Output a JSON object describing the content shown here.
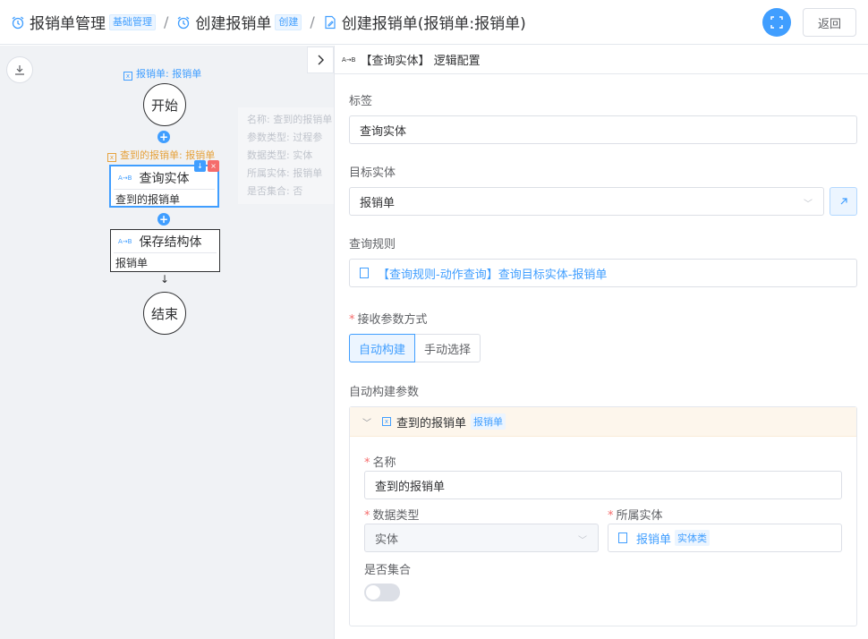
{
  "breadcrumb": [
    {
      "label": "报销单管理",
      "tag": "基础管理"
    },
    {
      "label": "创建报销单",
      "tag": "创建"
    },
    {
      "label": "创建报销单(报销单:报销单)"
    }
  ],
  "separator": "/",
  "back_label": "返回",
  "flow": {
    "root_var": "报销单: 报销单",
    "start_label": "开始",
    "query_var": "查到的报销单: 报销单",
    "query_node": {
      "title": "查询实体",
      "subtitle": "查到的报销单"
    },
    "save_node": {
      "title": "保存结构体",
      "subtitle": "报销单"
    },
    "end_label": "结束",
    "info": [
      "名称: 查到的报销单",
      "参数类型: 过程参",
      "数据类型: 实体",
      "所属实体: 报销单",
      "是否集合: 否"
    ]
  },
  "panel": {
    "title": "【查询实体】 逻辑配置",
    "label_field": {
      "label": "标签",
      "value": "查询实体"
    },
    "target_entity": {
      "label": "目标实体",
      "value": "报销单"
    },
    "query_rule": {
      "label": "查询规则",
      "value": "【查询规则-动作查询】查询目标实体-报销单"
    },
    "receive_mode": {
      "label": "接收参数方式",
      "options": [
        "自动构建",
        "手动选择"
      ],
      "selected": "自动构建"
    },
    "auto_params": {
      "label": "自动构建参数",
      "param_name": "查到的报销单",
      "param_tag": "报销单",
      "name_label": "名称",
      "name_value": "查到的报销单",
      "dtype_label": "数据类型",
      "dtype_value": "实体",
      "entity_label": "所属实体",
      "entity_value": "报销单",
      "entity_tag": "实体类",
      "collection_label": "是否集合",
      "collection_on": false
    }
  },
  "colors": {
    "accent": "#409eff",
    "danger": "#f56c6c",
    "warning": "#e6a23c"
  }
}
